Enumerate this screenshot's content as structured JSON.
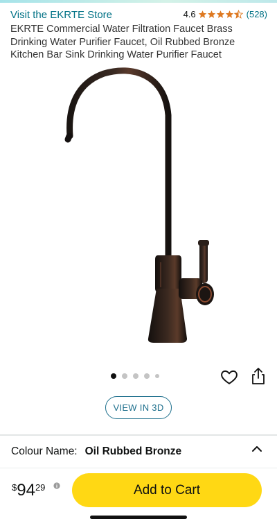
{
  "store": {
    "link_label": "Visit the EKRTE Store"
  },
  "rating": {
    "value": "4.6",
    "stars": 4.5,
    "count": "(528)",
    "star_color": "#de7921"
  },
  "product": {
    "title": "EKRTE Commercial Water Filtration Faucet Brass Drinking Water Purifier Faucet, Oil Rubbed Bronze Kitchen Bar Sink Drinking Water Purifier Faucet",
    "image_alt": "oil-rubbed-bronze-faucet"
  },
  "carousel": {
    "total": 5,
    "active_index": 0
  },
  "actions": {
    "heart_icon": "heart-icon",
    "share_icon": "share-icon"
  },
  "view3d": {
    "label": "VIEW IN 3D"
  },
  "colour": {
    "label": "Colour Name:",
    "value": "Oil Rubbed Bronze"
  },
  "buy": {
    "currency": "$",
    "price_whole": "94",
    "price_fraction": "29",
    "add_to_cart_label": "Add to Cart",
    "button_color": "#ffd814"
  },
  "colors": {
    "link": "#007185",
    "accent": "#1d6f8c"
  }
}
